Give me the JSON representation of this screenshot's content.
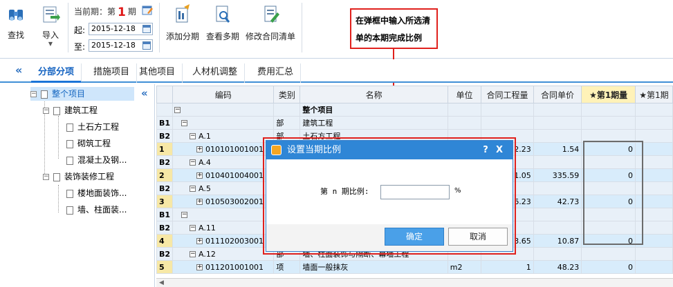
{
  "toolbar": {
    "find_label": "查找",
    "import_label": "导入",
    "period_prefix": "当前期：第",
    "period_number": "1",
    "period_suffix": "期",
    "start_label": "起:",
    "start_date": "2015-12-18",
    "end_label": "至:",
    "end_date": "2015-12-18",
    "add_period_label": "添加分期",
    "view_multi_label": "查看多期",
    "edit_contract_label": "修改合同清单"
  },
  "callout": {
    "line1": "在弹框中输入所选清",
    "line2": "单的本期完成比例"
  },
  "tabs": [
    "分部分项",
    "措施项目",
    "其他项目",
    "人材机调整",
    "费用汇总"
  ],
  "tree": {
    "root": "整个项目",
    "building": "建筑工程",
    "earth": "土石方工程",
    "masonry": "砌筑工程",
    "concrete": "混凝土及钢...",
    "decoration": "装饰装修工程",
    "floor": "楼地面装饰...",
    "wall": "墙、柱面装..."
  },
  "grid": {
    "headers": [
      "编码",
      "类别",
      "名称",
      "单位",
      "合同工程量",
      "合同单价",
      "★第1期量",
      "★第1期"
    ],
    "rows": [
      {
        "rn": "",
        "code": "整个项目",
        "type": "",
        "name": "整个项目",
        "unit": "",
        "qty": "",
        "price": "",
        "p1": ""
      },
      {
        "rn": "B1",
        "code": "",
        "type": "部",
        "name": "建筑工程",
        "unit": "",
        "qty": "",
        "price": "",
        "p1": ""
      },
      {
        "rn": "B2",
        "code": "A.1",
        "type": "部",
        "name": "土石方工程",
        "unit": "",
        "qty": "",
        "price": "",
        "p1": ""
      },
      {
        "rn": "1",
        "code": "010101001001",
        "type": "",
        "name": "",
        "unit": "",
        "qty": "2.23",
        "price": "1.54",
        "p1": "0"
      },
      {
        "rn": "B2",
        "code": "A.4",
        "type": "",
        "name": "",
        "unit": "",
        "qty": "",
        "price": "",
        "p1": ""
      },
      {
        "rn": "2",
        "code": "010401004001",
        "type": "",
        "name": "",
        "unit": "",
        "qty": "1.05",
        "price": "335.59",
        "p1": "0"
      },
      {
        "rn": "B2",
        "code": "A.5",
        "type": "",
        "name": "",
        "unit": "",
        "qty": "",
        "price": "",
        "p1": ""
      },
      {
        "rn": "3",
        "code": "010503002001",
        "type": "",
        "name": "",
        "unit": "",
        "qty": "6.23",
        "price": "42.73",
        "p1": "0"
      },
      {
        "rn": "B1",
        "code": "",
        "type": "",
        "name": "",
        "unit": "",
        "qty": "",
        "price": "",
        "p1": ""
      },
      {
        "rn": "B2",
        "code": "A.11",
        "type": "",
        "name": "",
        "unit": "",
        "qty": "",
        "price": "",
        "p1": ""
      },
      {
        "rn": "4",
        "code": "011102003001",
        "type": "",
        "name": "",
        "unit": "",
        "qty": "3.65",
        "price": "10.87",
        "p1": "0"
      },
      {
        "rn": "B2",
        "code": "A.12",
        "type": "部",
        "name": "墙、柱面装饰与隔断、幕墙工程",
        "unit": "",
        "qty": "",
        "price": "",
        "p1": ""
      },
      {
        "rn": "5",
        "code": "011201001001",
        "type": "项",
        "name": "墙面一般抹灰",
        "unit": "m2",
        "qty": "1",
        "price": "48.23",
        "p1": "0"
      }
    ]
  },
  "dialog": {
    "title": "设置当期比例",
    "help": "?",
    "close": "X",
    "label": "第 n 期比例:",
    "input_value": "",
    "unit": "%",
    "ok": "确定",
    "cancel": "取消"
  },
  "colors": {
    "accent": "#2f86d6",
    "highlight": "#e0201c"
  }
}
